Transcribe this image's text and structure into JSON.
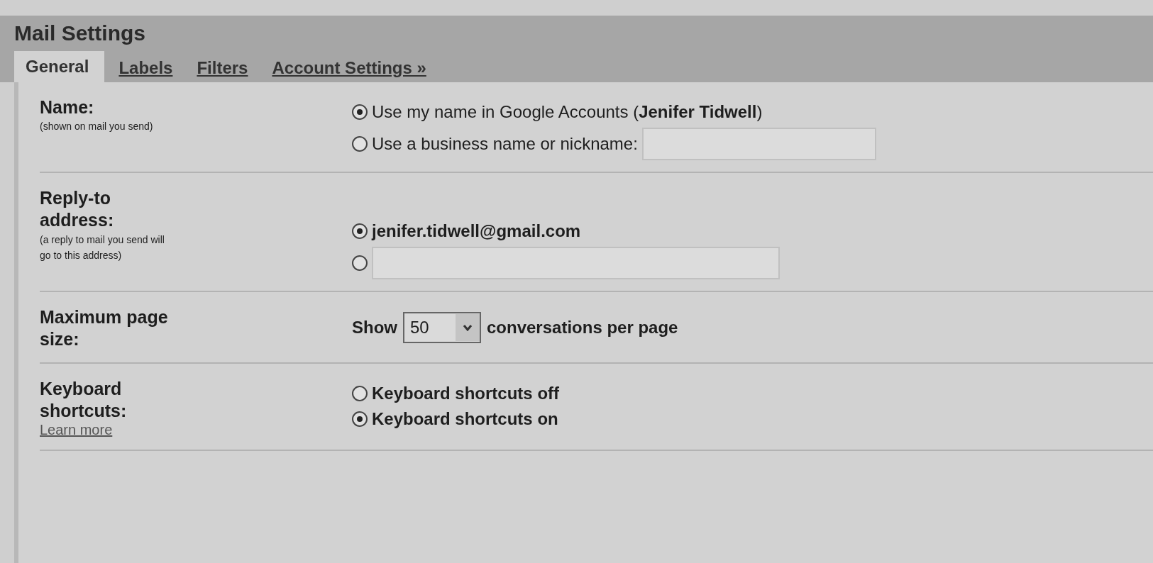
{
  "window": {
    "title": "Mail Settings"
  },
  "tabs": [
    {
      "label": "General",
      "selected": true
    },
    {
      "label": "Labels",
      "selected": false
    },
    {
      "label": "Filters",
      "selected": false
    },
    {
      "label": "Account Settings »",
      "selected": false
    }
  ],
  "settings": [
    {
      "label": "Name:",
      "hint": "(shown on mail you send)",
      "options": [
        {
          "kind": "radio",
          "text": "Use my name in Google Accounts (**Jenifer Tidwell**)",
          "bold": false,
          "selected": true
        },
        {
          "kind": "radio-field",
          "text": "Use a business name or nickname:",
          "bold": false,
          "selected": false
        }
      ]
    },
    {
      "label": "Reply-to address:",
      "hint": "(a reply to mail you send will go to this address)",
      "options": [
        {
          "kind": "radio",
          "text": "jenifer.tidwell@gmail.com",
          "bold": true,
          "selected": true
        },
        {
          "kind": "radio-field",
          "selected": false
        }
      ]
    },
    {
      "label": "Maximum page size:",
      "options": [
        {
          "kind": "select",
          "before": "Show",
          "value": "50",
          "after": "conversations per page"
        }
      ]
    },
    {
      "label": "Keyboard shortcuts:",
      "link": "Learn more",
      "options": [
        {
          "kind": "radio",
          "text": "Keyboard shortcuts off",
          "bold": true,
          "selected": false
        },
        {
          "kind": "radio",
          "text": "Keyboard shortcuts on",
          "bold": true,
          "selected": true
        }
      ]
    }
  ]
}
